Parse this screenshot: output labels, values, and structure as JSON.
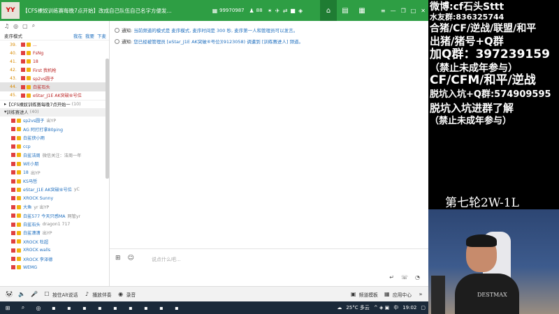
{
  "titlebar": {
    "logo": "YY",
    "title": "【CFS裸奴训练赛每晚7点开始】改成自己队伍自己名字方便发...",
    "id": "99970987",
    "people": "88"
  },
  "left": {
    "mode": "麦序模式",
    "links": [
      "我在",
      "我要",
      "下麦"
    ],
    "queue": [
      {
        "num": "39.",
        "name": "..."
      },
      {
        "num": "40.",
        "name": "FsNg"
      },
      {
        "num": "41.",
        "name": "18"
      },
      {
        "num": "42.",
        "name": "First 我机枪"
      },
      {
        "num": "43.",
        "name": "sp2vs圆子"
      },
      {
        "num": "44.",
        "name": "白鲨石头"
      },
      {
        "num": "45.",
        "name": "eStar_J1E AK突破⑥号位"
      }
    ],
    "channel": "【CFS裸奴训练赛每晚7点开始一",
    "channel_count": "(10)",
    "sub_channel": "训练赛进人",
    "sub_count": "(40)",
    "members": [
      {
        "name": "sp2vs圆子",
        "note": "出YP"
      },
      {
        "name": "AG 阿打打拿80ping",
        "note": ""
      },
      {
        "name": "白鲨侠小雨",
        "note": ""
      },
      {
        "name": "ccp",
        "note": ""
      },
      {
        "name": "白鲨洁周",
        "note": "微信关注：洁周一年"
      },
      {
        "name": "WE小朋",
        "note": ""
      },
      {
        "name": "18",
        "note": "出YP"
      },
      {
        "name": "KS马哲",
        "note": ""
      },
      {
        "name": "eStar_J1E AK突破⑥号位",
        "note": "yC"
      },
      {
        "name": "XROCK Sunny",
        "note": ""
      },
      {
        "name": "大鱼",
        "note": "yr 出YP"
      },
      {
        "name": "白鲨577 今天只感MA",
        "note": "网管yr"
      },
      {
        "name": "白鲨石头",
        "note": "dragon1 717"
      },
      {
        "name": "白鲨潇潇",
        "note": "出YP"
      },
      {
        "name": "XROCK 杜超",
        "note": ""
      },
      {
        "name": "XROCK walls",
        "note": ""
      },
      {
        "name": "XROCK 李泽德",
        "note": ""
      },
      {
        "name": "WEMG",
        "note": ""
      }
    ]
  },
  "messages": [
    {
      "label": "通知:",
      "text": "当前频道的模式是 麦序模式, 麦序时间是 300 秒, 麦序第一人和管理员可以发言。"
    },
    {
      "label": "通知:",
      "text": "您已经被管理员 [eStar_J1E AK突破⑥号位](9123058) 调遣到 [训练赛进人] 频道。"
    }
  ],
  "input": {
    "placeholder": "说点什么吧..."
  },
  "bottombar": {
    "press_talk": "按住Alt说话",
    "accompany": "播放伴奏",
    "record": "录音",
    "template": "频道模板",
    "app_center": "应用中心"
  },
  "taskbar": {
    "weather": "25°C 多云",
    "ime": "中",
    "time": "19:02"
  },
  "overlay": {
    "lines": [
      "微博:cf石头Sttt",
      "水友群:836325744",
      "合猪/CF/逆战/联盟/和平",
      "出猪/猪号+Q群",
      "加Q群：397239159",
      "（禁止未成年参与）",
      "CF/CFM/和平/逆战",
      "脱坑入坑+Q群:574909595",
      "脱坑入坑进群了解",
      "（禁止未成年参与）"
    ],
    "round": "第七轮2W-1L",
    "shirt": "DESTMAX"
  },
  "colors": {
    "titlebar": "#2e9e44",
    "link": "#1f6fbf",
    "queue_num": "#d98a00"
  }
}
